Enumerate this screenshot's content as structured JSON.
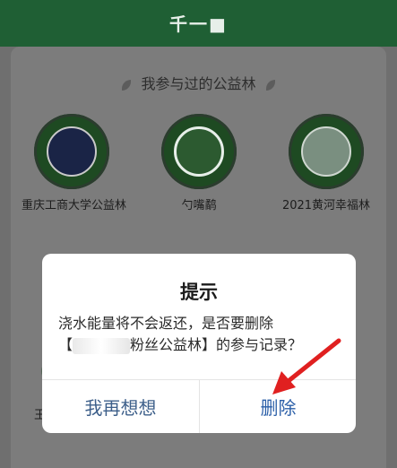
{
  "header": {
    "title": "千一■"
  },
  "section": {
    "title": "我参与过的公益林"
  },
  "forests": [
    {
      "name": "重庆工商大学公益林"
    },
    {
      "name": "勺嘴鹬"
    },
    {
      "name": "2021黄河幸福林"
    }
  ],
  "row2": {
    "label": "王一"
  },
  "modal": {
    "title": "提示",
    "message_line1": "浇水能量将不会返还，是否要删除",
    "message_line2_prefix": "【",
    "message_line2_suffix": "粉丝公益林】的参与记录？",
    "cancel_label": "我再想想",
    "delete_label": "删除"
  },
  "colors": {
    "header_green": "#1f5f34",
    "arrow_red": "#e02020",
    "delete_blue": "#2b5fa8"
  }
}
